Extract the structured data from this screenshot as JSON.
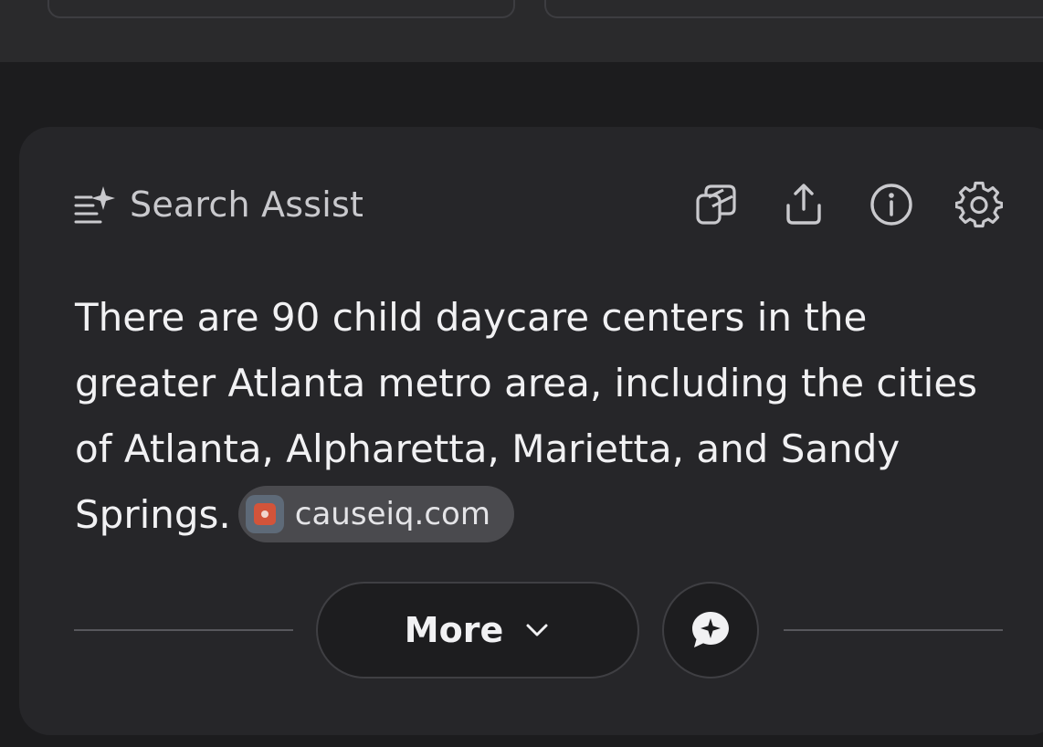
{
  "panel": {
    "title": "Search Assist",
    "icons": {
      "header": "sparkle-list-icon",
      "copy": "copy-icon",
      "share": "share-icon",
      "info": "info-icon",
      "settings": "gear-icon"
    }
  },
  "answer": {
    "text": "There are 90 child daycare centers in the greater Atlanta metro area, including the cities of Atlanta, Alpharetta, Marietta, and Sandy Springs."
  },
  "source": {
    "label": "causeiq.com",
    "icon": "causeiq-favicon"
  },
  "footer": {
    "more_label": "More",
    "more_icon": "chevron-down-icon",
    "chat_icon": "chat-sparkle-icon"
  },
  "colors": {
    "background": "#1c1c1e",
    "card": "#262629",
    "text": "#f1f1f3",
    "chip": "#4a4a4e",
    "favicon_accent": "#d2543a"
  }
}
